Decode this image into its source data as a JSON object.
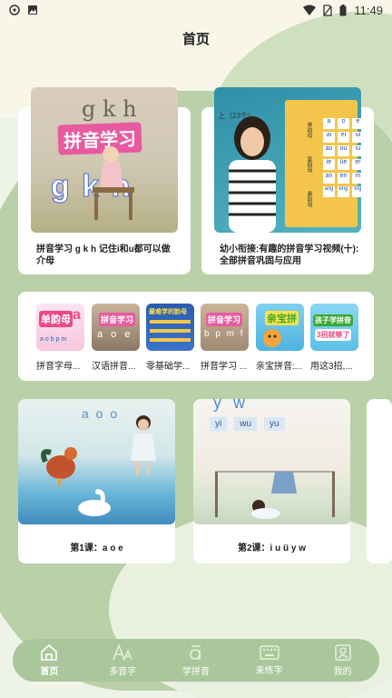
{
  "status_bar": {
    "time": "11:49"
  },
  "header": {
    "title": "首页"
  },
  "featured": [
    {
      "thumb_text": "拼音学习",
      "letters": "g k h",
      "caption": "拼音学习 g k h 记住i和u都可以做介母"
    },
    {
      "caption": "幼小衔接:有趣的拼音学习视频(十):全部拼音巩固与应用",
      "chart_head": "上（23个）",
      "chart_rows": [
        [
          "a",
          "o",
          "e"
        ],
        [
          "ai",
          "ei",
          "ui"
        ],
        [
          "ao",
          "ou",
          "iu"
        ],
        [
          "ie",
          "üe",
          "er"
        ],
        [
          "an",
          "en",
          "in"
        ],
        [
          "ang",
          "eng",
          "ing"
        ]
      ],
      "chart_side": [
        "单韵母",
        "复韵母",
        "鼻韵母"
      ]
    }
  ],
  "mini_items": [
    {
      "label": "拼音字母...",
      "thumb_text": "单韵母",
      "sub": "a",
      "row": "a o b p m"
    },
    {
      "label": "汉语拼音...",
      "thumb_text": "拼音学习",
      "row": "a o e"
    },
    {
      "label": "零基础学...",
      "thumb_text": "最难学的韵母"
    },
    {
      "label": "拼音学习 ...",
      "thumb_text": "拼音学习",
      "row": "b p m f"
    },
    {
      "label": "亲宝拼音:...",
      "thumb_text": "亲宝拼"
    },
    {
      "label": "用这3招,...",
      "thumb_text": "孩子学拼音",
      "sub": "3招就够了"
    }
  ],
  "lessons": [
    {
      "title": "第1课：a o e",
      "letters": "a o o"
    },
    {
      "title": "第2课：i u ü y w",
      "top_letters": "y w",
      "syllables": [
        "yi",
        "wu",
        "yu"
      ]
    }
  ],
  "nav": [
    {
      "label": "首页",
      "active": true
    },
    {
      "label": "多音字"
    },
    {
      "label": "学拼音"
    },
    {
      "label": "来练字"
    },
    {
      "label": "我的"
    }
  ],
  "colors": {
    "nav_bg": "#a9c79a",
    "accent_pink": "#e85aa0",
    "card": "#ffffff"
  }
}
